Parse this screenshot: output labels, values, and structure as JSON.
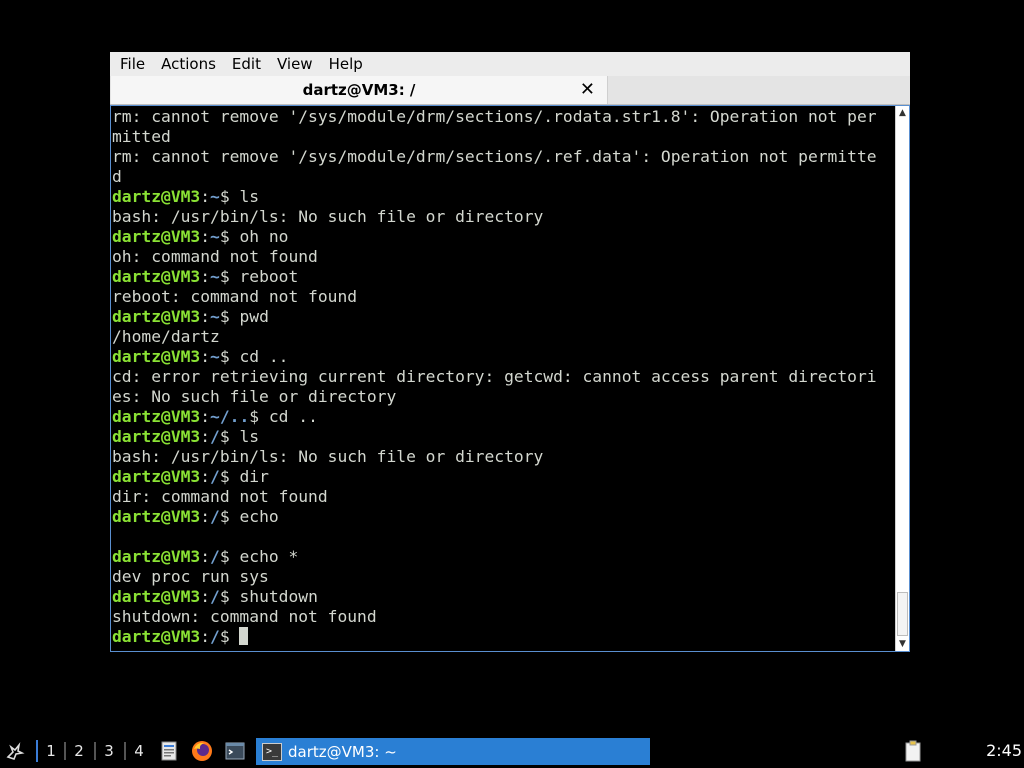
{
  "menubar": {
    "items": [
      "File",
      "Actions",
      "Edit",
      "View",
      "Help"
    ]
  },
  "tab": {
    "title": "dartz@VM3: /",
    "close_icon": "close-icon"
  },
  "terminal": {
    "colors": {
      "user": "#8ae234",
      "path": "#729fcf",
      "text": "#d3d7cf"
    },
    "lines": [
      {
        "out": "rm: cannot remove '/sys/module/drm/sections/.rodata.str1.8': Operation not per"
      },
      {
        "out": "mitted"
      },
      {
        "out": "rm: cannot remove '/sys/module/drm/sections/.ref.data': Operation not permitte"
      },
      {
        "out": "d"
      },
      {
        "user": "dartz@VM3",
        "path": "~",
        "cmd": "ls"
      },
      {
        "out": "bash: /usr/bin/ls: No such file or directory"
      },
      {
        "user": "dartz@VM3",
        "path": "~",
        "cmd": "oh no"
      },
      {
        "out": "oh: command not found"
      },
      {
        "user": "dartz@VM3",
        "path": "~",
        "cmd": "reboot"
      },
      {
        "out": "reboot: command not found"
      },
      {
        "user": "dartz@VM3",
        "path": "~",
        "cmd": "pwd"
      },
      {
        "out": "/home/dartz"
      },
      {
        "user": "dartz@VM3",
        "path": "~",
        "cmd": "cd .."
      },
      {
        "out": "cd: error retrieving current directory: getcwd: cannot access parent directori"
      },
      {
        "out": "es: No such file or directory"
      },
      {
        "user": "dartz@VM3",
        "path": "~/..",
        "cmd": "cd .."
      },
      {
        "user": "dartz@VM3",
        "path": "/",
        "cmd": "ls"
      },
      {
        "out": "bash: /usr/bin/ls: No such file or directory"
      },
      {
        "user": "dartz@VM3",
        "path": "/",
        "cmd": "dir"
      },
      {
        "out": "dir: command not found"
      },
      {
        "user": "dartz@VM3",
        "path": "/",
        "cmd": "echo"
      },
      {
        "out": ""
      },
      {
        "user": "dartz@VM3",
        "path": "/",
        "cmd": "echo *"
      },
      {
        "out": "dev proc run sys"
      },
      {
        "user": "dartz@VM3",
        "path": "/",
        "cmd": "shutdown"
      },
      {
        "out": "shutdown: command not found"
      },
      {
        "user": "dartz@VM3",
        "path": "/",
        "cmd": "",
        "cursor": true
      }
    ]
  },
  "taskbar": {
    "start_icon": "start-menu-icon",
    "workspaces": [
      "1",
      "2",
      "3",
      "4"
    ],
    "launchers": [
      "file-manager-icon",
      "firefox-icon",
      "terminal-launcher-icon"
    ],
    "task_label": "dartz@VM3: ~",
    "clipboard_icon": "clipboard-icon",
    "clock": "2:45"
  }
}
